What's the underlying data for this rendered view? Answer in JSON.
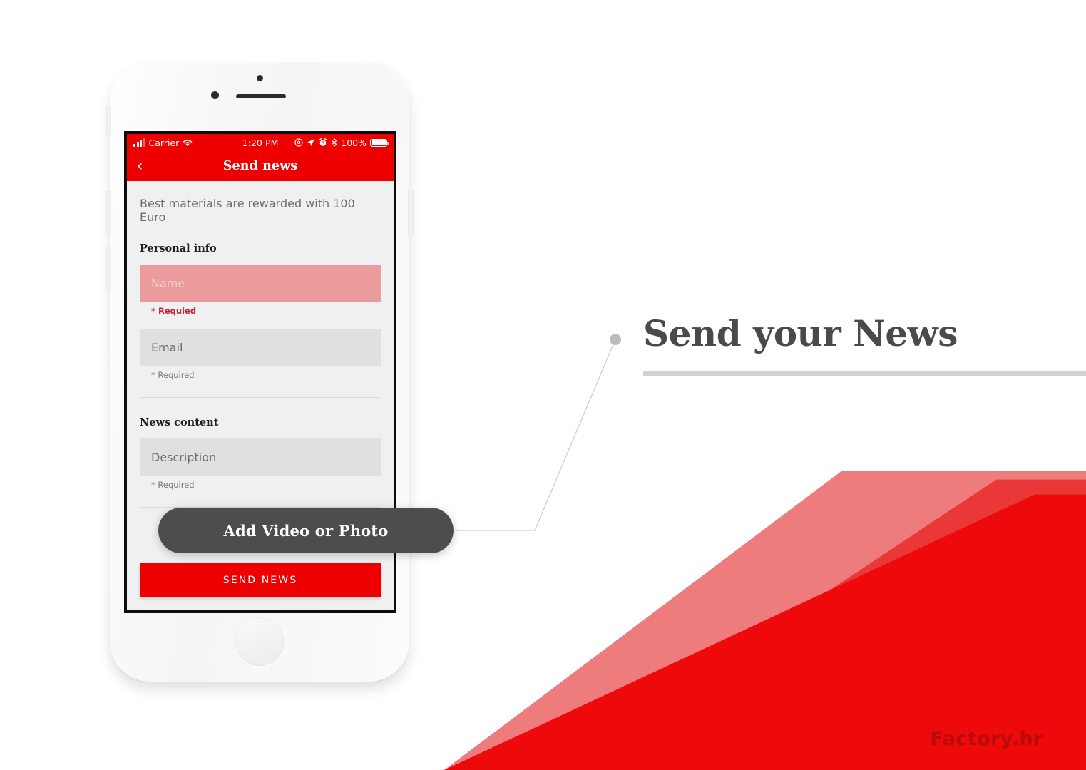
{
  "page": {
    "watermark": "Factory.hr",
    "accent_red": "#ee0000",
    "callout_gray": "#4d4d4d",
    "screen_bg": "#eff0f2"
  },
  "headline": {
    "text": "Send your News"
  },
  "callout": {
    "label": "Add Video or Photo"
  },
  "phone": {
    "statusbar": {
      "carrier": "Carrier",
      "time": "1:20 PM",
      "battery_percent": "100%",
      "icons": {
        "signal": "signal-bars-icon",
        "wifi": "wifi-icon",
        "do_not_disturb": "do-not-disturb-icon",
        "location": "location-arrow-icon",
        "alarm": "alarm-clock-icon",
        "bluetooth": "bluetooth-icon",
        "battery": "battery-icon"
      }
    },
    "navbar": {
      "back_icon": "chevron-left-icon",
      "title": "Send news"
    },
    "form": {
      "promo": "Best materials are rewarded with 100 Euro",
      "sections": [
        {
          "title": "Personal info",
          "fields": [
            {
              "placeholder": "Name",
              "hint": "* Requied",
              "state": "error"
            },
            {
              "placeholder": "Email",
              "hint": "* Required",
              "state": "normal"
            }
          ]
        },
        {
          "title": "News content",
          "fields": [
            {
              "placeholder": "Description",
              "hint": "* Required",
              "state": "normal"
            }
          ]
        }
      ],
      "submit_label": "SEND NEWS"
    }
  }
}
